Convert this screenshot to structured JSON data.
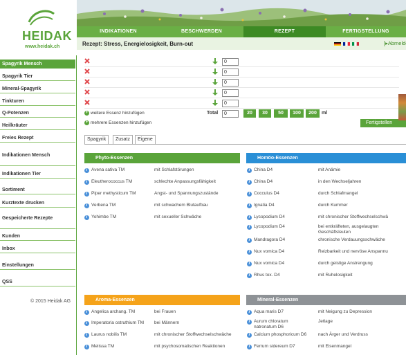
{
  "brand": {
    "name": "HEIDAK",
    "url": "www.heidak.ch",
    "copyright": "© 2015 Heidak AG"
  },
  "sidebar": {
    "items": [
      "Spagyrik Mensch",
      "Spagyrik Tier",
      "Mineral-Spagyrik",
      "Tinkturen",
      "Q-Potenzen",
      "Heilkräuter",
      "Freies Rezept",
      "Indikationen Mensch",
      "Indikationen Tier",
      "Sortiment",
      "Kurztexte drucken",
      "Gespeicherte Rezepte",
      "Kunden",
      "Inbox",
      "Einstellungen",
      "QSS"
    ]
  },
  "tabs": [
    "INDIKATIONEN",
    "BESCHWERDEN",
    "REZEPT",
    "FERTIGSTELLUNG"
  ],
  "recipe": {
    "title": "Rezept: Stress, Energielosigkeit, Burn-out",
    "logout": "Abmelden",
    "rows": [
      "0",
      "0",
      "0",
      "0",
      "0"
    ],
    "add_one": "weitere Essenz hinzufügen",
    "add_many": "mehrere Essenzen hinzufügen",
    "total_label": "Total",
    "total_value": "0",
    "ml_options": [
      "20",
      "30",
      "50",
      "100",
      "200"
    ],
    "ml_unit": "ml",
    "finish": "Fertigstellen"
  },
  "subtabs": [
    "Spagyrik",
    "Zusatz",
    "Eigene"
  ],
  "categories": {
    "phyto": {
      "title": "Phyto-Essenzen",
      "items": [
        {
          "name": "Avena sativa TM",
          "desc": "mit Schlafstörungen"
        },
        {
          "name": "Eleutherococcus TM",
          "desc": "schlechte Anpassungsfähigkeit"
        },
        {
          "name": "Piper methysticum TM",
          "desc": "Angst- und Spannungszustände"
        },
        {
          "name": "Verbena TM",
          "desc": "mit schwachem Blutaufbau"
        },
        {
          "name": "Yohimbe TM",
          "desc": "mit sexueller Schwäche"
        }
      ]
    },
    "homoeo": {
      "title": "Homöo-Essenzen",
      "items": [
        {
          "name": "China D4",
          "desc": "mit Anämie"
        },
        {
          "name": "China D4",
          "desc": "in den Wechseljahren"
        },
        {
          "name": "Cocculus D4",
          "desc": "durch Schlafmangel"
        },
        {
          "name": "Ignatia D4",
          "desc": "durch Kummer"
        },
        {
          "name": "Lycopodium D4",
          "desc": "mit chronischer Stoffwechselschwä"
        },
        {
          "name": "Lycopodium D4",
          "desc": "bei entkräfteten, ausgelaugten Geschäftsleuten"
        },
        {
          "name": "Mandragora D4",
          "desc": "chronische Verdauungsschwäche"
        },
        {
          "name": "Nux vomica D4",
          "desc": "Reizbarkeit und nervöse Anspannu"
        },
        {
          "name": "Nux vomica D4",
          "desc": "durch geistige Anstrengung"
        },
        {
          "name": "Rhus tox. D4",
          "desc": "mit Ruhelosigkeit"
        }
      ]
    },
    "aroma": {
      "title": "Aroma-Essenzen",
      "items": [
        {
          "name": "Angelica archang. TM",
          "desc": "bei Frauen"
        },
        {
          "name": "Imperatoria ostruthium TM",
          "desc": "bei Männern"
        },
        {
          "name": "Laurus nobilis TM",
          "desc": "mit chronischer Stoffwechselschwäche"
        },
        {
          "name": "Melissa TM",
          "desc": "mit psychosomatischen Reaktionen"
        }
      ]
    },
    "mineral": {
      "title": "Mineral-Essenzen",
      "items": [
        {
          "name": "Aqua maris D7",
          "desc": "mit Neigung zu Depression"
        },
        {
          "name": "Aurum chloratum natronatum D6",
          "desc": "Jetlage"
        },
        {
          "name": "Calcium phosphoricum D6",
          "desc": "nach Ärger und Verdruss"
        },
        {
          "name": "Ferrum sidereum D7",
          "desc": "mit Eisenmangel"
        }
      ]
    }
  },
  "colors": {
    "green": "#5aa43a",
    "dark_green": "#3d8a24",
    "homoeo": "#2a8fd6",
    "aroma": "#f5a31a",
    "mineral": "#8e9296",
    "delete": "#e0464a",
    "info": "#4a90d9"
  }
}
